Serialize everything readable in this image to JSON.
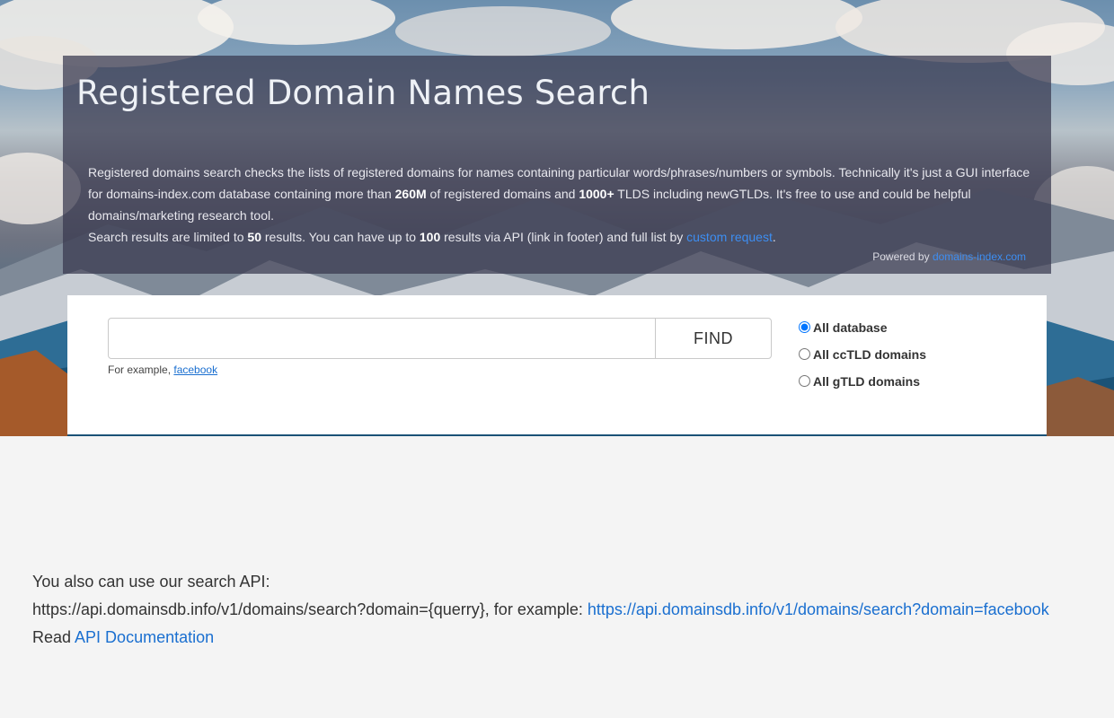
{
  "header": {
    "title": "Registered Domain Names Search",
    "desc_p1": "Registered domains search checks the lists of registered domains for names containing particular words/phrases/numbers or symbols. Technically it's just a GUI interface for domains-index.com database containing more than ",
    "desc_260m": "260M",
    "desc_p2": " of registered domains and ",
    "desc_1000": "1000+",
    "desc_p3": " TLDS including newGTLDs. It's free to use and could be helpful domains/marketing research tool.",
    "limit_p1": "Search results are limited to ",
    "limit_50": "50",
    "limit_p2": " results. You can have up to ",
    "limit_100": "100",
    "limit_p3": " results via API (link in footer) and full list by ",
    "custom_request_link": "custom request",
    "limit_end": ".",
    "powered_by": "Powered by",
    "powered_link": "domains-index.com"
  },
  "search": {
    "input_value": "",
    "find_label": "FIND",
    "example_prefix": "For example,",
    "example_link": "facebook"
  },
  "filters": [
    {
      "label": "All database",
      "checked": true
    },
    {
      "label": "All ccTLD domains",
      "checked": false
    },
    {
      "label": "All gTLD domains",
      "checked": false
    }
  ],
  "api": {
    "intro": "You also can use our search API:",
    "template": "https://api.domainsdb.info/v1/domains/search?domain={querry}, for example:",
    "example_link": "https://api.domainsdb.info/v1/domains/search?domain=facebook",
    "read_prefix": "Read",
    "docs_link": "API Documentation"
  },
  "colors": {
    "link": "#1a6fd0",
    "overlay": "#37384e",
    "page_bg": "#f4f4f4"
  }
}
